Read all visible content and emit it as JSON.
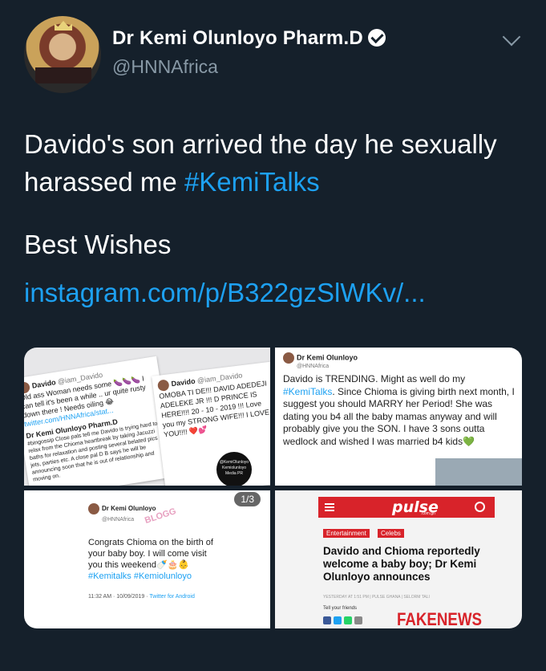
{
  "author": {
    "name": "Dr Kemi Olunloyo Pharm.D",
    "handle": "@HNNAfrica",
    "verified": true
  },
  "tweet": {
    "text_before_hashtag": "Davido's son arrived the day he sexually harassed me ",
    "hashtag": "#KemiTalks",
    "line2": "Best Wishes",
    "link": "instagram.com/p/B322gzSlWKv/..."
  },
  "media": {
    "pager": "1/3",
    "img1": {
      "card1_name": "Davido",
      "card1_handle": "@iam_Davido",
      "card1_text": "Old ass Woman needs some 🍆🍆🍆 I can tell it's been a while .. ur quite rusty down there ! Needs oiling 😂",
      "card1_link": "twitter.com/HNNAfrica/stat...",
      "card1_reply_name": "Dr Kemi Olunloyo Pharm.D",
      "card1_reply_text": "#bingossip Close pals tell me Davido is trying hard to relax from the Chioma heartbreak by taking Jacuzzi baths for relaxation and posting several belated pics in jets, parties etc. A close pal D B says he will be announcing soon that he is out of relationship and moving on.",
      "card2_name": "Davido",
      "card2_handle": "@iam_Davido",
      "card2_text": "OMOBA TI DE!!! DAVID ADEDEJI ADELEKE JR !!! D PRINCE IS HERE!!!! 20 - 10 - 2019 !!! Love you my STRONG WIFE!!! I LOVE YOU!!!! ❤️💕",
      "watermark": "@KemiOlunloyo Kemiolunloyo Media PR"
    },
    "img2": {
      "name": "Dr Kemi Olunloyo",
      "handle": "@HNNAfrica",
      "text_a": "Davido is TRENDING. Might as well do my ",
      "hashtag": "#KemiTalks",
      "text_b": ". Since Chioma is giving birth next month, I suggest you should MARRY her Period! She was dating you b4 all the baby mamas anyway and will probably give you the SON. I have 3 sons outta wedlock and wished I was married b4 kids💚"
    },
    "img3": {
      "name": "Dr Kemi Olunloyo",
      "handle": "@HNNAfrica",
      "text": "Congrats Chioma on the birth of your baby boy. I will come visit you this weekend🍼🎂👶",
      "hashtags": "#Kemitalks #Kemiolunloyo",
      "meta_time": "11:32 AM · 10/09/2019 ·",
      "meta_app": "Twitter for Android",
      "watermark": "BLOGG"
    },
    "img4": {
      "brand": "pulse",
      "brand_sub": ".com.gh",
      "tag1": "Entertainment",
      "tag2": "Celebs",
      "headline": "Davido and Chioma reportedly welcome a baby boy; Dr Kemi Olunloyo announces",
      "meta": "YESTERDAY AT 1:51 PM | PULSE GHANA | SELORM TALI",
      "tell": "Tell your friends",
      "stamp": "FAKENEWS"
    }
  },
  "colors": {
    "background": "#15202b",
    "link": "#1da1f2",
    "secondary_text": "#8899a6",
    "pulse_red": "#d8232a"
  }
}
